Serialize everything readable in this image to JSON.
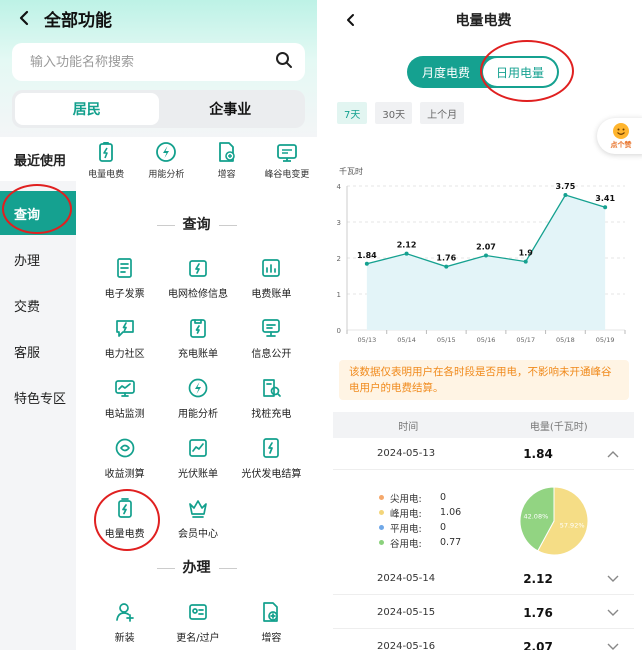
{
  "left": {
    "title": "全部功能",
    "search_placeholder": "输入功能名称搜索",
    "segments": [
      "居民",
      "企事业"
    ],
    "sidebar": [
      "最近使用",
      "查询",
      "办理",
      "交费",
      "客服",
      "特色专区"
    ],
    "recent": [
      {
        "label": "电量电费",
        "icon": "battery-bolt-icon"
      },
      {
        "label": "用能分析",
        "icon": "bolt-circle-icon"
      },
      {
        "label": "增容",
        "icon": "document-plus-icon"
      },
      {
        "label": "峰谷电变更",
        "icon": "monitor-icon"
      }
    ],
    "section_query": "查询",
    "query_items": [
      {
        "label": "电子发票",
        "icon": "invoice-icon"
      },
      {
        "label": "电网检修信息",
        "icon": "maintenance-icon"
      },
      {
        "label": "电费账单",
        "icon": "bar-chart-icon"
      },
      {
        "label": "电力社区",
        "icon": "chat-bolt-icon"
      },
      {
        "label": "充电账单",
        "icon": "charging-bill-icon"
      },
      {
        "label": "信息公开",
        "icon": "info-board-icon"
      },
      {
        "label": "电站监测",
        "icon": "station-monitor-icon"
      },
      {
        "label": "用能分析",
        "icon": "bolt-circle-icon"
      },
      {
        "label": "找桩充电",
        "icon": "find-charger-icon"
      },
      {
        "label": "收益测算",
        "icon": "revenue-icon"
      },
      {
        "label": "光伏账单",
        "icon": "solar-bill-icon"
      },
      {
        "label": "光伏发电结算",
        "icon": "solar-settle-icon"
      },
      {
        "label": "电量电费",
        "icon": "battery-bolt-icon"
      },
      {
        "label": "会员中心",
        "icon": "crown-icon"
      }
    ],
    "section_handle": "办理",
    "handle_items": [
      {
        "label": "新装",
        "icon": "user-plus-icon"
      },
      {
        "label": "更名/过户",
        "icon": "transfer-icon"
      },
      {
        "label": "增容",
        "icon": "document-plus-icon"
      }
    ]
  },
  "right": {
    "title": "电量电费",
    "tabs": [
      "月度电费",
      "日用电量"
    ],
    "ranges": [
      "7天",
      "30天",
      "上个月"
    ],
    "badge": "点个赞",
    "notice": "该数据仅表明用户在各时段是否用电，不影响未开通峰谷电用户的电费结算。",
    "table_headers": [
      "时间",
      "电量(千瓦时)"
    ],
    "rows": [
      {
        "date": "2024-05-13",
        "value": "1.84"
      },
      {
        "date": "2024-05-14",
        "value": "2.12"
      },
      {
        "date": "2024-05-15",
        "value": "1.76"
      },
      {
        "date": "2024-05-16",
        "value": "2.07"
      }
    ],
    "breakdown": [
      {
        "label": "尖用电:",
        "value": "0",
        "color": "#f5a86b"
      },
      {
        "label": "峰用电:",
        "value": "1.06",
        "color": "#f3d57a"
      },
      {
        "label": "平用电:",
        "value": "0",
        "color": "#6fa8e8"
      },
      {
        "label": "谷用电:",
        "value": "0.77",
        "color": "#8bd17c"
      }
    ],
    "pie": [
      {
        "label": "57.92%",
        "value": 57.92,
        "color": "#f5dd86"
      },
      {
        "label": "42.08%",
        "value": 42.08,
        "color": "#92d482"
      }
    ]
  },
  "chart_data": {
    "type": "area",
    "ylabel": "千瓦时",
    "categories": [
      "05/13",
      "05/14",
      "05/15",
      "05/16",
      "05/17",
      "05/18",
      "05/19"
    ],
    "values": [
      1.84,
      2.12,
      1.76,
      2.07,
      1.9,
      3.75,
      3.41
    ],
    "labels": [
      "1.84",
      "2.12",
      "1.76",
      "2.07",
      "1.9",
      "3.75",
      "3.41"
    ],
    "ylim": [
      0,
      4
    ],
    "yticks": [
      "0",
      "1",
      "2",
      "3",
      "4"
    ],
    "grid": true,
    "line_color": "#15a190",
    "fill_color": "#e3f4f8"
  }
}
